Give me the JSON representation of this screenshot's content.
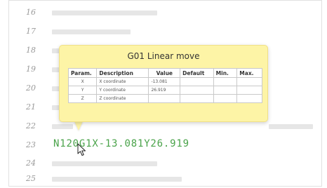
{
  "editor": {
    "lines": [
      {
        "number": "16"
      },
      {
        "number": "17"
      },
      {
        "number": "18"
      },
      {
        "number": "19"
      },
      {
        "number": "20"
      },
      {
        "number": "21"
      },
      {
        "number": "22"
      },
      {
        "number": "23",
        "code": "N120G1X-13.081Y26.919"
      },
      {
        "number": "24"
      },
      {
        "number": "25"
      }
    ]
  },
  "tooltip": {
    "title": "G01 Linear move",
    "headers": {
      "param": "Param.",
      "description": "Description",
      "value": "Value",
      "default": "Default",
      "min": "Min.",
      "max": "Max."
    },
    "rows": [
      {
        "param": "X",
        "description": "X coordinate",
        "value": "-13.081",
        "default": "",
        "min": "",
        "max": ""
      },
      {
        "param": "Y",
        "description": "Y coordinate",
        "value": "26.919",
        "default": "",
        "min": "",
        "max": ""
      },
      {
        "param": "Z",
        "description": "Z coordinate",
        "value": "",
        "default": "",
        "min": "",
        "max": ""
      }
    ]
  },
  "colors": {
    "code_text": "#4aa34a",
    "tooltip_background": "#fdf4a6",
    "line_number": "#9a9a9a",
    "placeholder_bar": "#e6e6e6"
  },
  "icons": {
    "cursor": "mouse-pointer-icon"
  }
}
